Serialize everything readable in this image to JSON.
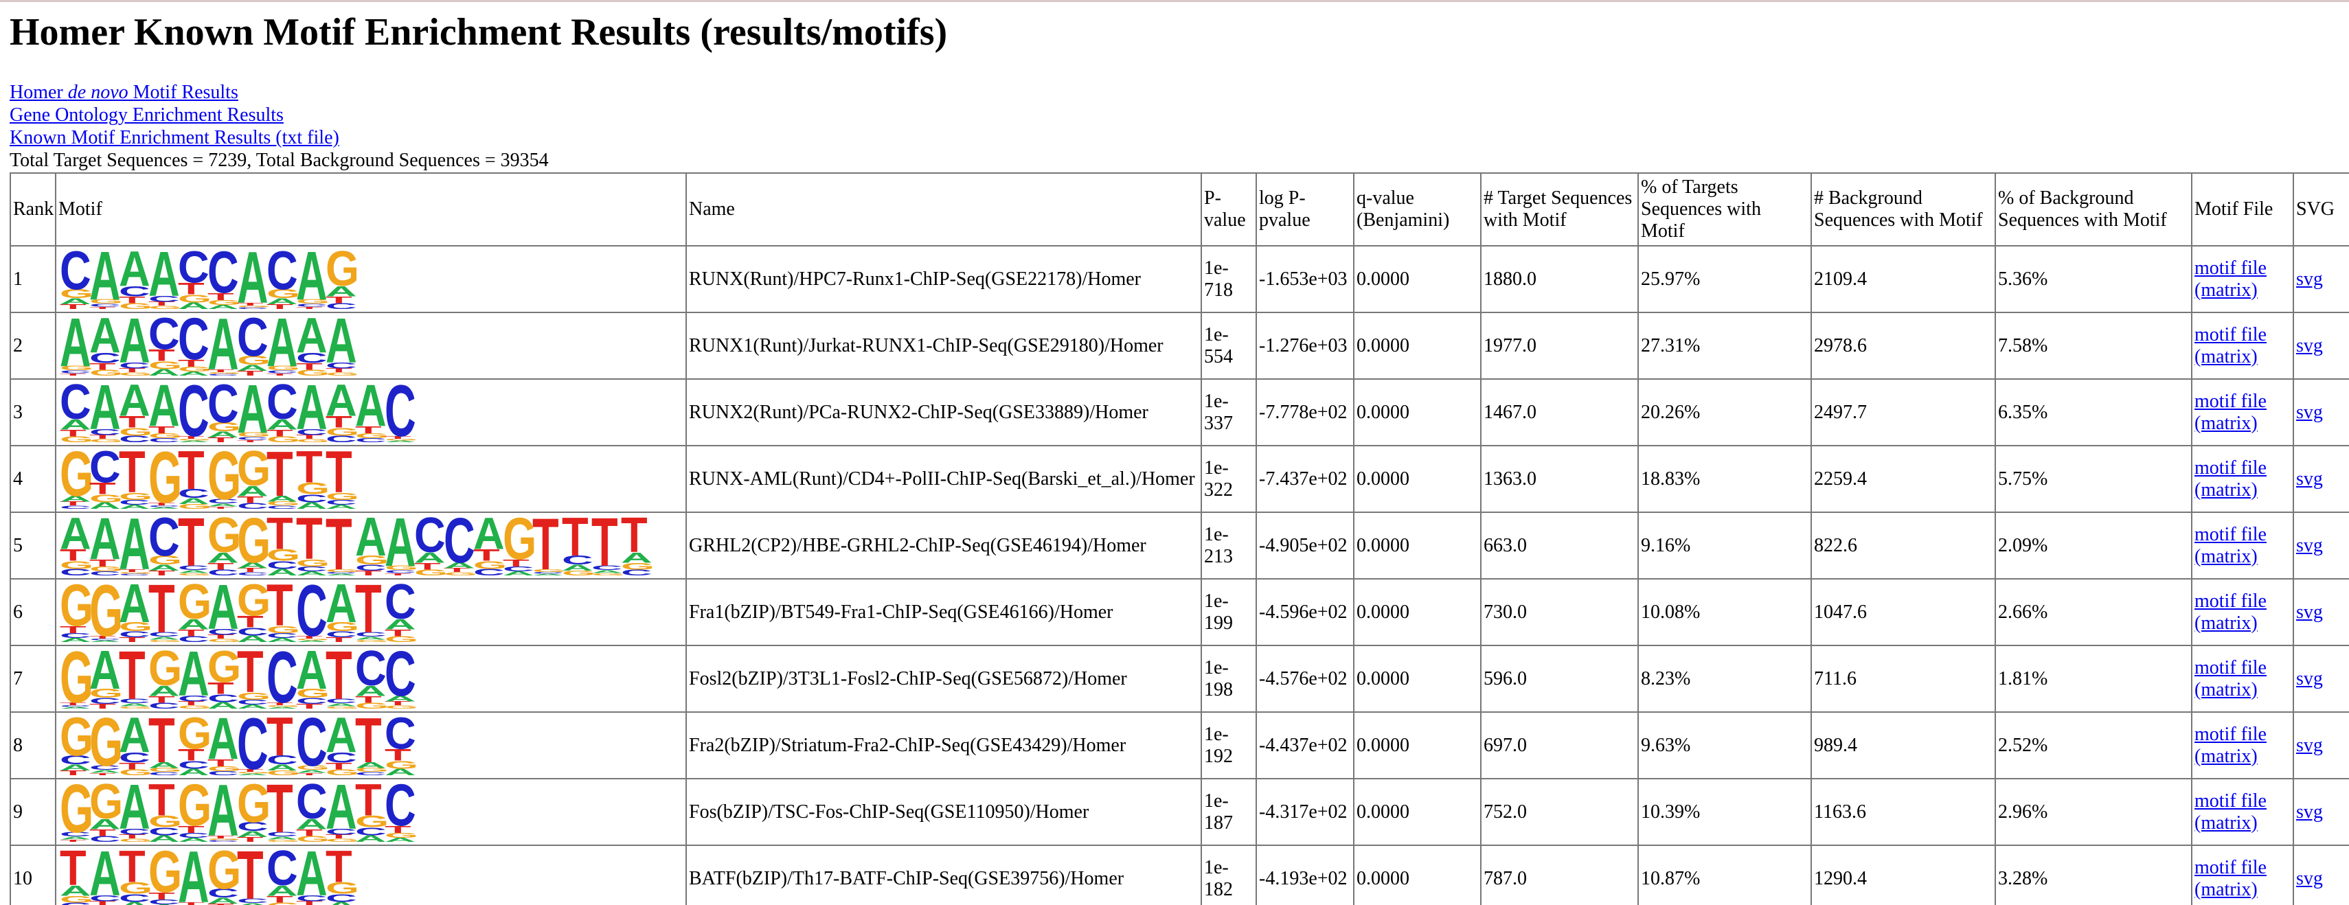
{
  "page": {
    "title": "Homer Known Motif Enrichment Results (results/motifs)"
  },
  "links": {
    "denovo_prefix": "Homer ",
    "denovo_italic": "de novo",
    "denovo_suffix": " Motif Results",
    "go": "Gene Ontology Enrichment Results",
    "known_txt": "Known Motif Enrichment Results (txt file)"
  },
  "summary": "Total Target Sequences = 7239, Total Background Sequences = 39354",
  "table": {
    "headers": {
      "rank": "Rank",
      "motif": "Motif",
      "name": "Name",
      "pvalue": "P-value",
      "logp": "log P-pvalue",
      "qvalue": "q-value (Benjamini)",
      "target": "# Target Sequences with Motif",
      "pct_target": "% of Targets Sequences with Motif",
      "bg": "# Background Sequences with Motif",
      "pct_bg": "% of Background Sequences with Motif",
      "motif_file": "Motif File",
      "svg": "SVG"
    },
    "motif_file_label": "motif file (matrix)",
    "svg_label": "svg",
    "colors": {
      "A": "#21b04a",
      "C": "#1d23c9",
      "G": "#f0a51c",
      "T": "#e2211c"
    },
    "rows": [
      {
        "rank": "1",
        "logo": "CAAACCACAG",
        "name": "RUNX(Runt)/HPC7-Runx1-ChIP-Seq(GSE22178)/Homer",
        "pvalue": "1e-718",
        "logp": "-1.653e+03",
        "qvalue": "0.0000",
        "target": "1880.0",
        "pct_target": "25.97%",
        "bg": "2109.4",
        "pct_bg": "5.36%"
      },
      {
        "rank": "2",
        "logo": "AAACCACAAA",
        "name": "RUNX1(Runt)/Jurkat-RUNX1-ChIP-Seq(GSE29180)/Homer",
        "pvalue": "1e-554",
        "logp": "-1.276e+03",
        "qvalue": "0.0000",
        "target": "1977.0",
        "pct_target": "27.31%",
        "bg": "2978.6",
        "pct_bg": "7.58%"
      },
      {
        "rank": "3",
        "logo": "CAAACCACAAAC",
        "name": "RUNX2(Runt)/PCa-RUNX2-ChIP-Seq(GSE33889)/Homer",
        "pvalue": "1e-337",
        "logp": "-7.778e+02",
        "qvalue": "0.0000",
        "target": "1467.0",
        "pct_target": "20.26%",
        "bg": "2497.7",
        "pct_bg": "6.35%"
      },
      {
        "rank": "4",
        "logo": "GCTGTGGTTT",
        "name": "RUNX-AML(Runt)/CD4+-PolII-ChIP-Seq(Barski_et_al.)/Homer",
        "pvalue": "1e-322",
        "logp": "-7.437e+02",
        "qvalue": "0.0000",
        "target": "1363.0",
        "pct_target": "18.83%",
        "bg": "2259.4",
        "pct_bg": "5.75%"
      },
      {
        "rank": "5",
        "logo": "AAACTGGTTTAACCAGTTTT",
        "name": "GRHL2(CP2)/HBE-GRHL2-ChIP-Seq(GSE46194)/Homer",
        "pvalue": "1e-213",
        "logp": "-4.905e+02",
        "qvalue": "0.0000",
        "target": "663.0",
        "pct_target": "9.16%",
        "bg": "822.6",
        "pct_bg": "2.09%"
      },
      {
        "rank": "6",
        "logo": "GGATGAGTCATC",
        "name": "Fra1(bZIP)/BT549-Fra1-ChIP-Seq(GSE46166)/Homer",
        "pvalue": "1e-199",
        "logp": "-4.596e+02",
        "qvalue": "0.0000",
        "target": "730.0",
        "pct_target": "10.08%",
        "bg": "1047.6",
        "pct_bg": "2.66%"
      },
      {
        "rank": "7",
        "logo": "GATGAGTCATCC",
        "name": "Fosl2(bZIP)/3T3L1-Fosl2-ChIP-Seq(GSE56872)/Homer",
        "pvalue": "1e-198",
        "logp": "-4.576e+02",
        "qvalue": "0.0000",
        "target": "596.0",
        "pct_target": "8.23%",
        "bg": "711.6",
        "pct_bg": "1.81%"
      },
      {
        "rank": "8",
        "logo": "GGATGACTCATC",
        "name": "Fra2(bZIP)/Striatum-Fra2-ChIP-Seq(GSE43429)/Homer",
        "pvalue": "1e-192",
        "logp": "-4.437e+02",
        "qvalue": "0.0000",
        "target": "697.0",
        "pct_target": "9.63%",
        "bg": "989.4",
        "pct_bg": "2.52%"
      },
      {
        "rank": "9",
        "logo": "GGATGAGTCATC",
        "name": "Fos(bZIP)/TSC-Fos-ChIP-Seq(GSE110950)/Homer",
        "pvalue": "1e-187",
        "logp": "-4.317e+02",
        "qvalue": "0.0000",
        "target": "752.0",
        "pct_target": "10.39%",
        "bg": "1163.6",
        "pct_bg": "2.96%"
      },
      {
        "rank": "10",
        "logo": "TATGAGTCAT",
        "name": "BATF(bZIP)/Th17-BATF-ChIP-Seq(GSE39756)/Homer",
        "pvalue": "1e-182",
        "logp": "-4.193e+02",
        "qvalue": "0.0000",
        "target": "787.0",
        "pct_target": "10.87%",
        "bg": "1290.4",
        "pct_bg": "3.28%"
      }
    ]
  }
}
